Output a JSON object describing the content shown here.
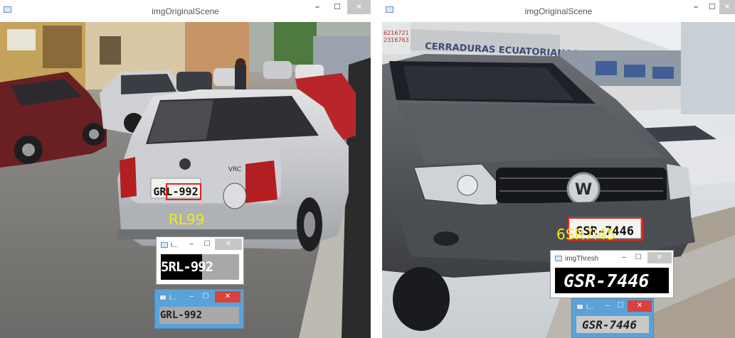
{
  "left_window": {
    "title": "imgOriginalScene",
    "controls": {
      "minimize": "–",
      "maximize": "☐",
      "close": "✕"
    },
    "detected_text": "RL99",
    "plate_text": "GRL-992",
    "thresh_window": {
      "title": "i...",
      "text": "5RL-992"
    },
    "plate_window": {
      "title": "i...",
      "text": "GRL-992"
    }
  },
  "right_window": {
    "title": "imgOriginalScene",
    "controls": {
      "minimize": "–",
      "maximize": "☐",
      "close": "✕"
    },
    "detected_text": "6SR7I45",
    "plate_text": "GSR-7446",
    "store_sign": "CERRADURAS ECUATORIANAS S.A",
    "phone_sign": "6216721\n2316763",
    "thresh_window": {
      "title": "imgThresh",
      "text": "GSR-7446"
    },
    "plate_window": {
      "title": "i...",
      "text": "GSR-7446"
    }
  },
  "colors": {
    "detection_box": "#e8231e",
    "ocr_text": "#f2e81d",
    "active_titlebar": "#5aa2d8",
    "close_active": "#d9413b"
  }
}
